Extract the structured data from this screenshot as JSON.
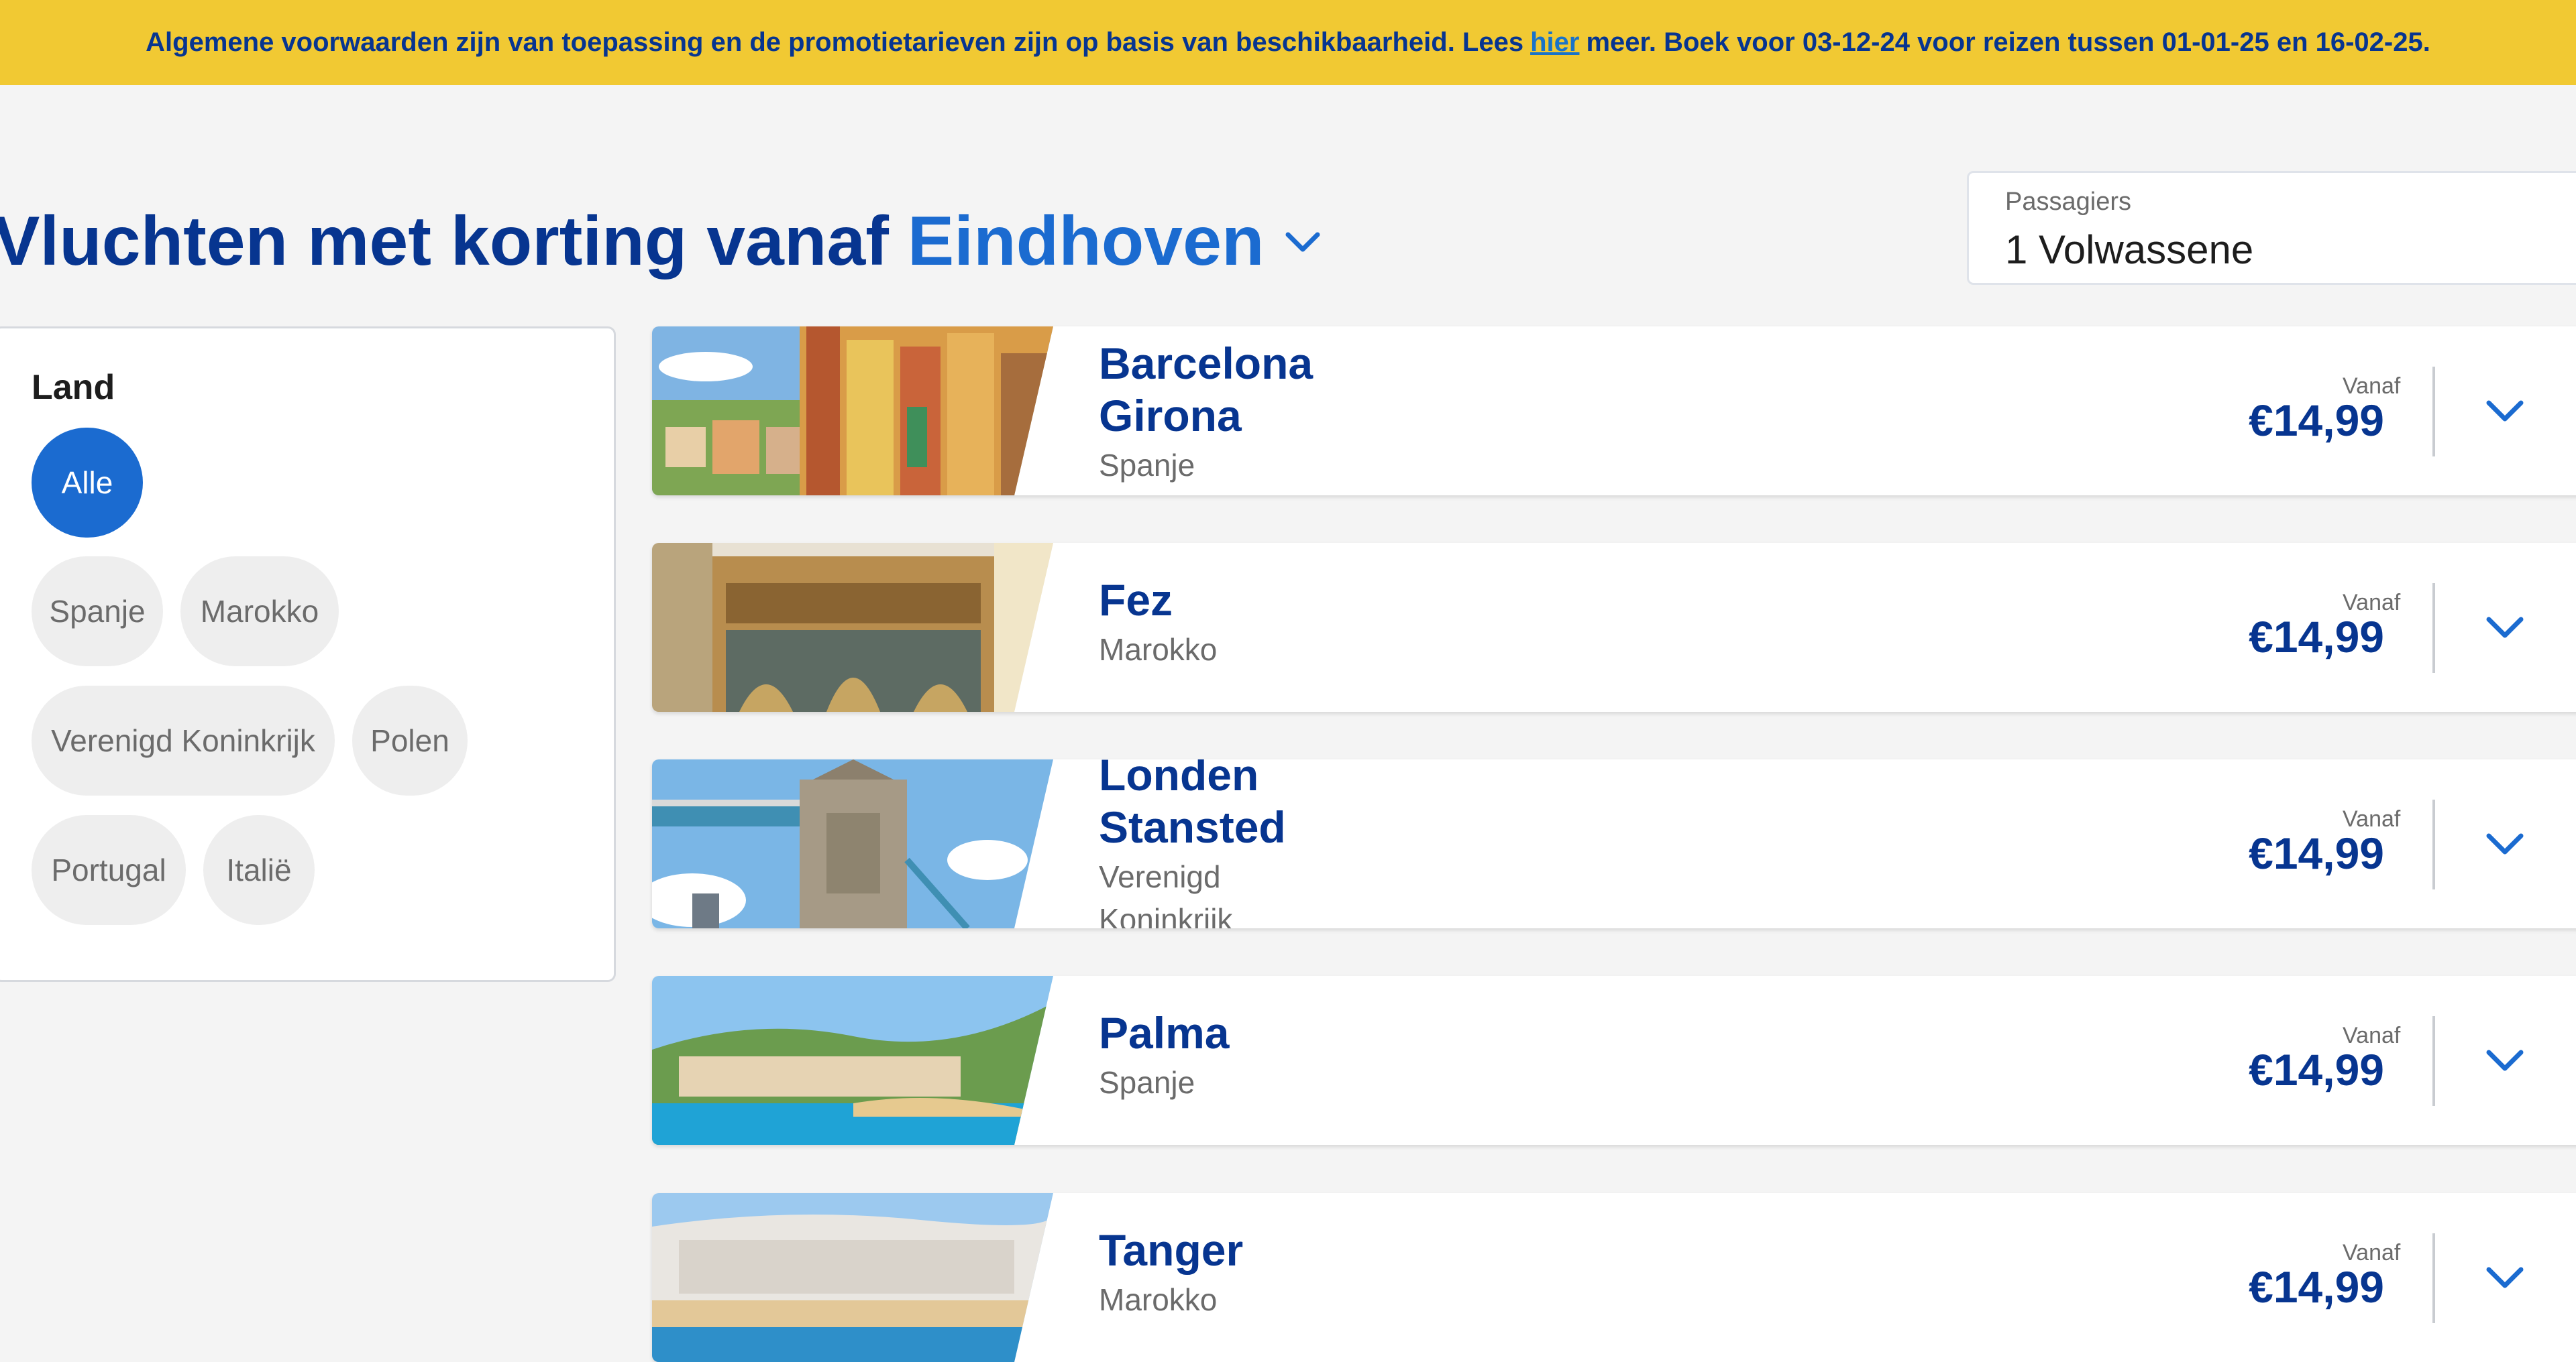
{
  "banner": {
    "text_before": "Algemene voorwaarden zijn van toepassing en de promotietarieven zijn op basis van beschikbaarheid. Lees",
    "link": "hier",
    "text_after": "meer. Boek voor 03-12-24 voor reizen tussen 01-01-25 en 16-02-25."
  },
  "heading": {
    "prefix": "Vluchten met korting vanaf",
    "origin": "Eindhoven"
  },
  "passengers": {
    "label": "Passagiers",
    "value": "1 Volwassene"
  },
  "filters": {
    "title": "Land",
    "chips": [
      "Alle",
      "Spanje",
      "Marokko",
      "Verenigd Koninkrijk",
      "Polen",
      "Portugal",
      "Italië"
    ],
    "selected": "Alle"
  },
  "destinations": [
    {
      "name_line1": "Barcelona",
      "name_line2": "Girona",
      "country_line1": "Spanje",
      "country_line2": "",
      "price_label": "Vanaf",
      "price": "€14,99"
    },
    {
      "name_line1": "Fez",
      "name_line2": "",
      "country_line1": "Marokko",
      "country_line2": "",
      "price_label": "Vanaf",
      "price": "€14,99"
    },
    {
      "name_line1": "Londen",
      "name_line2": "Stansted",
      "country_line1": "Verenigd",
      "country_line2": "Koninkrijk",
      "price_label": "Vanaf",
      "price": "€14,99"
    },
    {
      "name_line1": "Palma",
      "name_line2": "",
      "country_line1": "Spanje",
      "country_line2": "",
      "price_label": "Vanaf",
      "price": "€14,99"
    },
    {
      "name_line1": "Tanger",
      "name_line2": "",
      "country_line1": "Marokko",
      "country_line2": "",
      "price_label": "Vanaf",
      "price": "€14,99"
    }
  ],
  "colors": {
    "banner": "#f1c933",
    "navy": "#073590",
    "accent": "#1b6bd0"
  },
  "icons": {
    "origin_dropdown": "chevron-down-icon",
    "card_expand": "chevron-down-icon"
  }
}
